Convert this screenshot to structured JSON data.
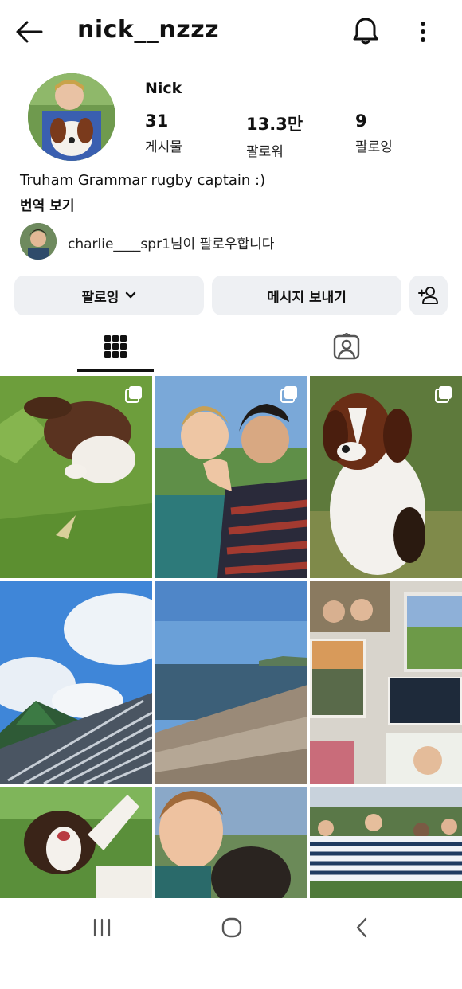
{
  "header": {
    "username": "nick__nzzz",
    "icons": {
      "back": "arrow-left-icon",
      "notifications": "bell-icon",
      "more": "more-vertical-icon"
    }
  },
  "profile": {
    "display_name": "Nick",
    "stats": [
      {
        "value": "31",
        "label": "게시물"
      },
      {
        "value": "13.3만",
        "label": "팔로워"
      },
      {
        "value": "9",
        "label": "팔로잉"
      }
    ],
    "bio": "Truham Grammar rugby captain :)",
    "translate": "번역 보기",
    "followed_by": "charlie____spr1님이 팔로우합니다"
  },
  "actions": {
    "following_label": "팔로잉",
    "message_label": "메시지 보내기",
    "icons": {
      "dropdown": "chevron-down-icon",
      "add_user": "add-user-icon"
    }
  },
  "tabs": [
    {
      "icon": "grid-icon",
      "active": true
    },
    {
      "icon": "tagged-person-icon",
      "active": false
    }
  ],
  "posts": [
    {
      "subject": "puppy playing on grass",
      "multi": true
    },
    {
      "subject": "two boys posing together",
      "multi": true
    },
    {
      "subject": "brown and white dog sitting",
      "multi": true
    },
    {
      "subject": "sky over striped tent",
      "multi": false
    },
    {
      "subject": "pebble beach and sea",
      "multi": false
    },
    {
      "subject": "photo collage",
      "multi": false
    },
    {
      "subject": "dog jumping up",
      "multi": false
    },
    {
      "subject": "boy selfie outdoors",
      "multi": false
    },
    {
      "subject": "rugby team group",
      "multi": false
    }
  ],
  "system_nav": {
    "icons": [
      "recent-apps-icon",
      "home-icon",
      "back-icon"
    ]
  },
  "colors": {
    "button_bg": "#eef0f3",
    "text": "#111111"
  }
}
